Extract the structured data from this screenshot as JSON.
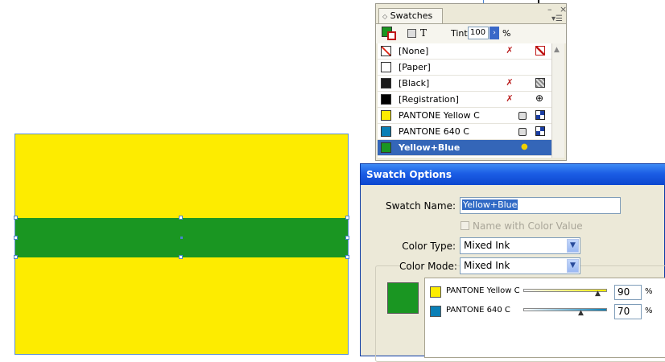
{
  "colors": {
    "yellow": "#fdec00",
    "green": "#1a9622",
    "blue": "#0a7fb6",
    "selection": "#3466b8",
    "titlebar": "#0c47cf"
  },
  "swatches_panel": {
    "tab_label": "Swatches",
    "tint_label": "Tint:",
    "tint_value": "100",
    "tint_unit": "%",
    "swatches": [
      {
        "name": "[None]",
        "color": "#ffffff",
        "icon1": "cross-out-icon",
        "icon2": "none-slash-icon"
      },
      {
        "name": "[Paper]",
        "color": "#ffffff",
        "icon1": "",
        "icon2": ""
      },
      {
        "name": "[Black]",
        "color": "#1a1a1a",
        "icon1": "cross-out-icon",
        "icon2": "gray-box-icon"
      },
      {
        "name": "[Registration]",
        "color": "#000000",
        "icon1": "cross-out-icon",
        "icon2": "registration-target-icon"
      },
      {
        "name": "PANTONE Yellow C",
        "color": "#fdec00",
        "icon1": "spot-color-icon",
        "icon2": "cmyk-mode-icon"
      },
      {
        "name": "PANTONE 640 C",
        "color": "#0a7fb6",
        "icon1": "spot-color-icon",
        "icon2": "cmyk-mode-icon"
      },
      {
        "name": "Yellow+Blue",
        "color": "#1a9622",
        "icon1": "",
        "icon2": "mixed-ink-icon"
      }
    ]
  },
  "dialog": {
    "title": "Swatch Options",
    "swatch_name_label": "Swatch Name:",
    "swatch_name_value": "Yellow+Blue",
    "name_with_color_value_label": "Name with Color Value",
    "color_type_label": "Color Type:",
    "color_type_value": "Mixed Ink",
    "color_mode_label": "Color Mode:",
    "color_mode_value": "Mixed Ink",
    "inks": [
      {
        "name": "PANTONE Yellow C",
        "value": "90",
        "unit": "%",
        "color": "#fdec00",
        "level": 0.9
      },
      {
        "name": "PANTONE 640 C",
        "value": "70",
        "unit": "%",
        "color": "#0a7fb6",
        "level": 0.7
      }
    ]
  }
}
